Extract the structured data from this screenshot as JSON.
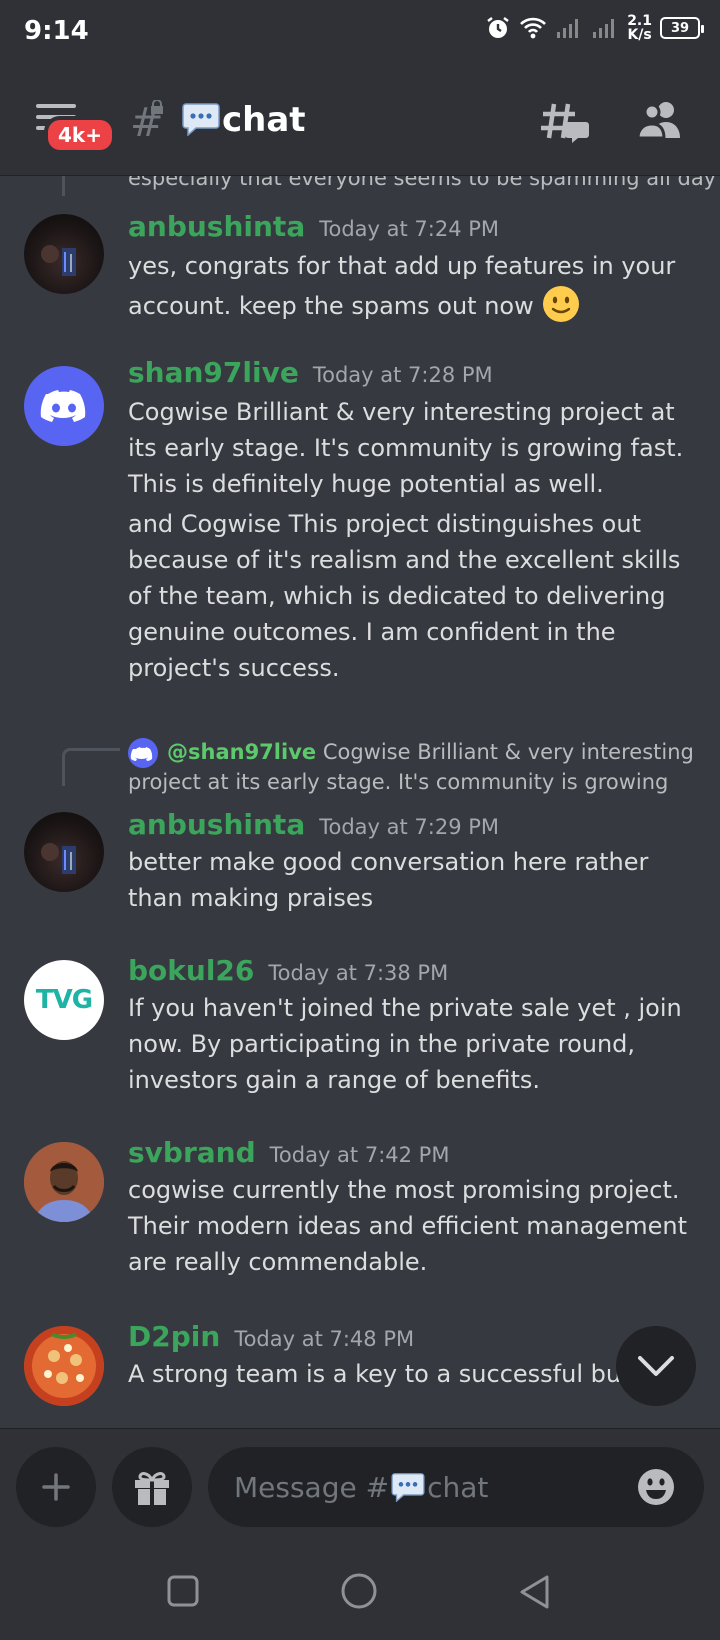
{
  "status_bar": {
    "time": "9:14",
    "net_speed_value": "2.1",
    "net_speed_unit": "K/s",
    "battery": "39"
  },
  "header": {
    "badge": "4k+",
    "channel_name": "chat",
    "icons": [
      "hamburger-icon",
      "locked-channel-icon",
      "speech-bubble-emoji",
      "threads-icon",
      "members-icon"
    ]
  },
  "messages": {
    "prev_reply_text": "especially that everyone seems to be spamming all day",
    "items": [
      {
        "username": "anbushinta",
        "user_color": "#3ba55c",
        "timestamp": "Today at 7:24 PM",
        "text": "yes, congrats for that add up features in your account. keep the spams out now"
      },
      {
        "username": "shan97live",
        "user_color": "#3ba55c",
        "timestamp": "Today at 7:28 PM",
        "text": "Cogwise Brilliant & very interesting project at its early stage. It's community is growing fast. This is definitely huge potential as well.",
        "text2": "and Cogwise This project distinguishes out because of it's realism and the excellent skills of the team, which is dedicated to delivering genuine outcomes. I am confident in the project's success."
      },
      {
        "reply_mention": "@shan97live",
        "reply_text": "Cogwise Brilliant & very interesting",
        "reply_text2": "project at its early stage. It's community is growing",
        "username": "anbushinta",
        "user_color": "#3ba55c",
        "timestamp": "Today at 7:29 PM",
        "text": "better make good conversation here rather than making praises"
      },
      {
        "username": "bokul26",
        "user_color": "#3ba55c",
        "timestamp": "Today at 7:38 PM",
        "avatar_text": "TVG",
        "text": "If you haven't joined the private sale yet ,  join now. By participating in the private round, investors gain a range of benefits."
      },
      {
        "username": "svbrand",
        "user_color": "#3ba55c",
        "timestamp": "Today at 7:42 PM",
        "text": "cogwise currently the most promising project. Their modern ideas and efficient management are really commendable."
      },
      {
        "username": "D2pin",
        "user_color": "#3ba55c",
        "timestamp": "Today at 7:48 PM",
        "text": "A strong team is a key to a successful busi"
      }
    ]
  },
  "composer": {
    "placeholder_prefix": "Message #",
    "placeholder_channel": "chat"
  },
  "colors": {
    "background": "#36393f",
    "header_bg": "#2f3136",
    "input_bg": "#202225",
    "username_green": "#3ba55c",
    "badge_red": "#ed4245",
    "blurple": "#5865f2"
  }
}
